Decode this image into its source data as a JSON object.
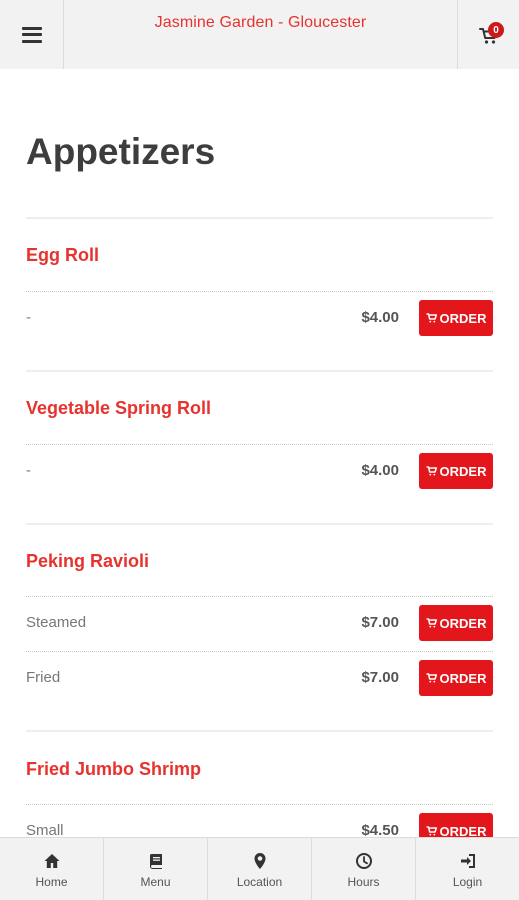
{
  "header": {
    "title": "Jasmine Garden - Gloucester",
    "cart_count": "0",
    "menu_icon": "hamburger-icon",
    "cart_icon": "cart-icon"
  },
  "colors": {
    "accent": "#e8322e",
    "button": "#e3161b",
    "badge": "#cc1a1a"
  },
  "page": {
    "title": "Appetizers"
  },
  "order_label": "ORDER",
  "sections": [
    {
      "name": "Egg Roll",
      "items": [
        {
          "label": "-",
          "price": "$4.00"
        }
      ]
    },
    {
      "name": "Vegetable Spring Roll",
      "items": [
        {
          "label": "-",
          "price": "$4.00"
        }
      ]
    },
    {
      "name": "Peking Ravioli",
      "items": [
        {
          "label": "Steamed",
          "price": "$7.00"
        },
        {
          "label": "Fried",
          "price": "$7.00"
        }
      ]
    },
    {
      "name": "Fried Jumbo Shrimp",
      "items": [
        {
          "label": "Small",
          "price": "$4.50"
        }
      ]
    }
  ],
  "bottom_nav": [
    {
      "label": "Home",
      "icon": "home-icon"
    },
    {
      "label": "Menu",
      "icon": "book-icon"
    },
    {
      "label": "Location",
      "icon": "map-pin-icon"
    },
    {
      "label": "Hours",
      "icon": "clock-icon"
    },
    {
      "label": "Login",
      "icon": "sign-in-icon"
    }
  ]
}
